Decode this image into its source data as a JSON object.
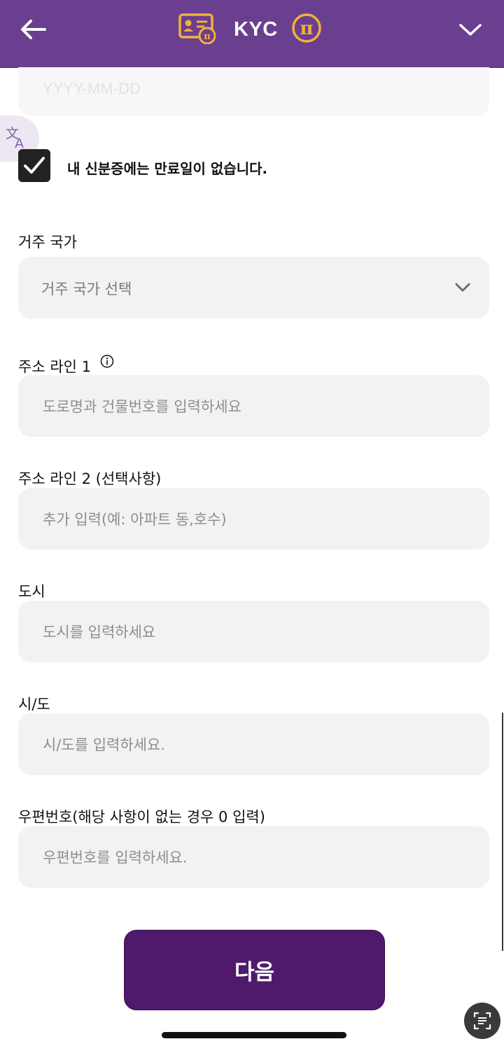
{
  "header": {
    "title": "KYC"
  },
  "expiry": {
    "date_placeholder": "YYYY-MM-DD",
    "no_expiry_label": "내 신분증에는 만료일이 없습니다.",
    "no_expiry_checked": true
  },
  "country": {
    "label": "거주 국가",
    "select_placeholder": "거주 국가 선택"
  },
  "address1": {
    "label": "주소 라인 1",
    "placeholder": "도로명과 건물번호를 입력하세요"
  },
  "address2": {
    "label": "주소 라인 2 (선택사항)",
    "placeholder": "추가 입력(예: 아파트 동,호수)"
  },
  "city": {
    "label": "도시",
    "placeholder": "도시를 입력하세요"
  },
  "province": {
    "label": "시/도",
    "placeholder": "시/도를 입력하세요."
  },
  "postal": {
    "label": "우편번호(해당 사항이 없는 경우 0 입력)",
    "placeholder": "우편번호를 입력하세요."
  },
  "actions": {
    "next_label": "다음"
  },
  "colors": {
    "header_bg": "#6b3f8f",
    "accent_gold": "#f0b23a",
    "button_bg": "#4f1a6b"
  }
}
